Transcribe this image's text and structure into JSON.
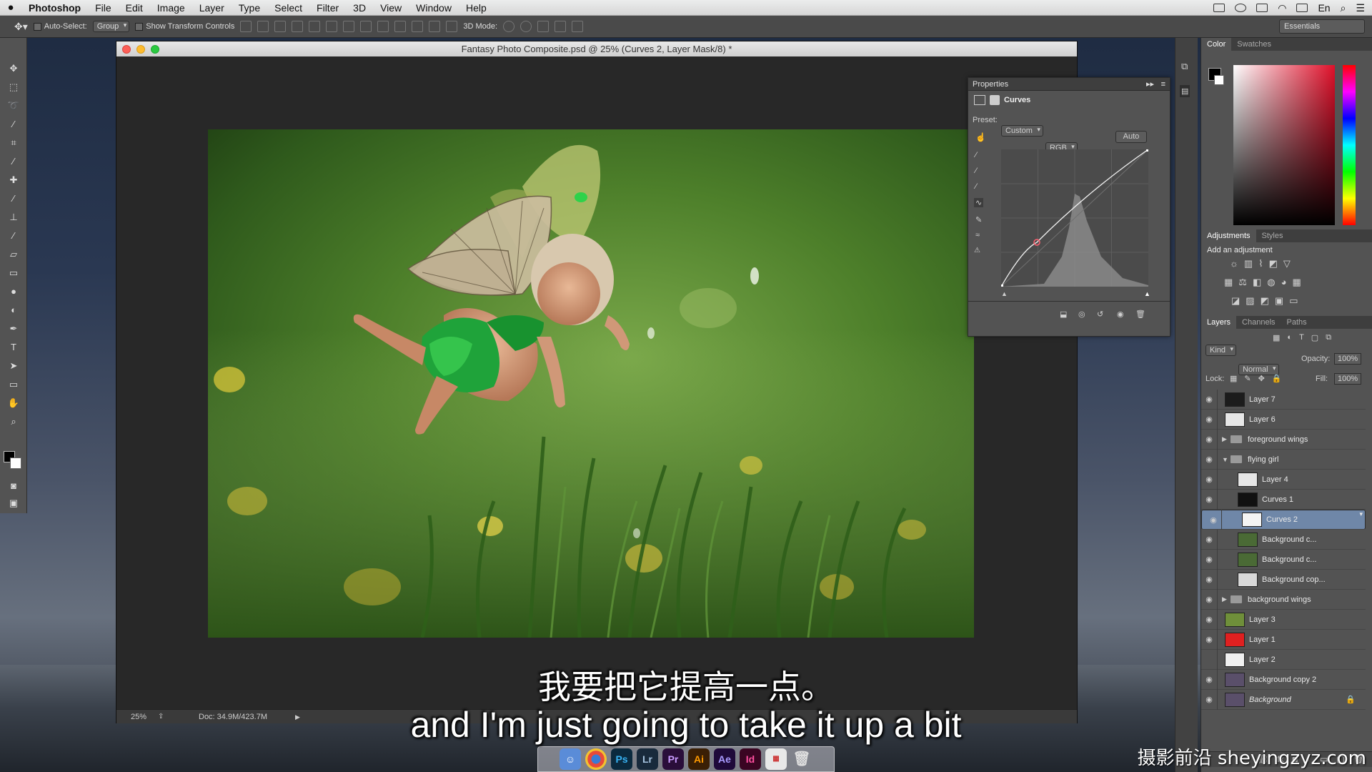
{
  "menubar": {
    "apple": "",
    "app_name": "Photoshop",
    "items": [
      "File",
      "Edit",
      "Image",
      "Layer",
      "Type",
      "Select",
      "Filter",
      "3D",
      "View",
      "Window",
      "Help"
    ],
    "input_source": "En"
  },
  "options_bar": {
    "auto_select_label": "Auto-Select:",
    "auto_select_value": "Group",
    "show_transform_label": "Show Transform Controls",
    "mode_3d_label": "3D Mode:",
    "workspace": "Essentials"
  },
  "document": {
    "title": "Fantasy Photo Composite.psd @ 25% (Curves 2, Layer Mask/8) *",
    "zoom": "25%",
    "doc_size": "Doc: 34.9M/423.7M"
  },
  "properties": {
    "panel_title": "Properties",
    "adjustment_name": "Curves",
    "preset_label": "Preset:",
    "preset_value": "Custom",
    "channel_value": "RGB",
    "auto_label": "Auto"
  },
  "color_panel": {
    "tabs": [
      "Color",
      "Swatches"
    ],
    "fg": "#000000",
    "bg": "#ffffff"
  },
  "adjustments_panel": {
    "tabs": [
      "Adjustments",
      "Styles"
    ],
    "add_label": "Add an adjustment"
  },
  "layers_panel": {
    "tabs": [
      "Layers",
      "Channels",
      "Paths"
    ],
    "filter_kind": "Kind",
    "blend_mode": "Normal",
    "opacity_label": "Opacity:",
    "opacity_value": "100%",
    "lock_label": "Lock:",
    "fill_label": "Fill:",
    "fill_value": "100%",
    "layers": [
      {
        "name": "Layer 7",
        "visible": true,
        "thumb": "#1c1c1c"
      },
      {
        "name": "Layer 6",
        "visible": true,
        "thumb": "#e6e6e6"
      },
      {
        "name": "foreground wings",
        "visible": true,
        "group": true
      },
      {
        "name": "flying girl",
        "visible": true,
        "group": true,
        "open": true
      },
      {
        "name": "Layer 4",
        "visible": true,
        "thumb": "#e6e6e6"
      },
      {
        "name": "Curves 1",
        "visible": true,
        "thumb": "#111111"
      },
      {
        "name": "Curves 2",
        "visible": true,
        "thumb": "#f4f4f4",
        "selected": true
      },
      {
        "name": "Background c...",
        "visible": true,
        "thumb": "#4a6a35"
      },
      {
        "name": "Background c...",
        "visible": true,
        "thumb": "#4a6a35"
      },
      {
        "name": "Background cop...",
        "visible": true,
        "thumb": "#d8d8d8"
      },
      {
        "name": "background wings",
        "visible": true,
        "group": true
      },
      {
        "name": "Layer 3",
        "visible": true,
        "thumb": "#6f8f3a"
      },
      {
        "name": "Layer 1",
        "visible": true,
        "thumb": "#e02020"
      },
      {
        "name": "Layer 2",
        "visible": false,
        "thumb": "#f0f0f0"
      },
      {
        "name": "Background copy 2",
        "visible": true,
        "thumb": "#5a4f6a"
      },
      {
        "name": "Background",
        "visible": true,
        "thumb": "#5a4f6a",
        "locked": true
      }
    ]
  },
  "dock_apps": [
    "Finder",
    "Chrome",
    "Ps",
    "Lr",
    "Pr",
    "Ai",
    "Ae",
    "Id",
    "Calendar",
    "Trash"
  ],
  "subtitles": {
    "cn": "我要把它提高一点。",
    "en": "and I'm just going to take it up a bit"
  },
  "watermark": "摄影前沿 sheyingzyz.com"
}
